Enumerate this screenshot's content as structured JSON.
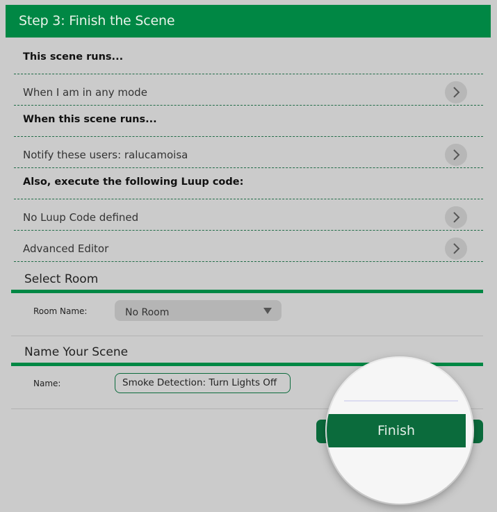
{
  "header": {
    "title": "Step 3: Finish the Scene"
  },
  "rows": [
    {
      "type": "section",
      "label": "This scene runs..."
    },
    {
      "type": "item",
      "label": "When I am in any mode"
    },
    {
      "type": "section",
      "label": "When this scene runs..."
    },
    {
      "type": "item",
      "label": "Notify these users: ralucamoisa"
    },
    {
      "type": "section",
      "label": "Also, execute the following Luup code:"
    },
    {
      "type": "item",
      "label": "No Luup Code defined"
    },
    {
      "type": "item",
      "label": "Advanced Editor"
    }
  ],
  "select_room": {
    "title": "Select Room",
    "label": "Room Name:",
    "selected": "No Room"
  },
  "name_scene": {
    "title": "Name Your Scene",
    "label": "Name:",
    "value": "Smoke Detection: Turn Lights Off"
  },
  "finish": {
    "label": "Finish"
  },
  "colors": {
    "accent": "#008744",
    "button": "#0b6b3c",
    "background": "#cbcbcb"
  },
  "icons": {
    "row_action": "chevron-right-icon",
    "dropdown": "caret-down-icon"
  }
}
